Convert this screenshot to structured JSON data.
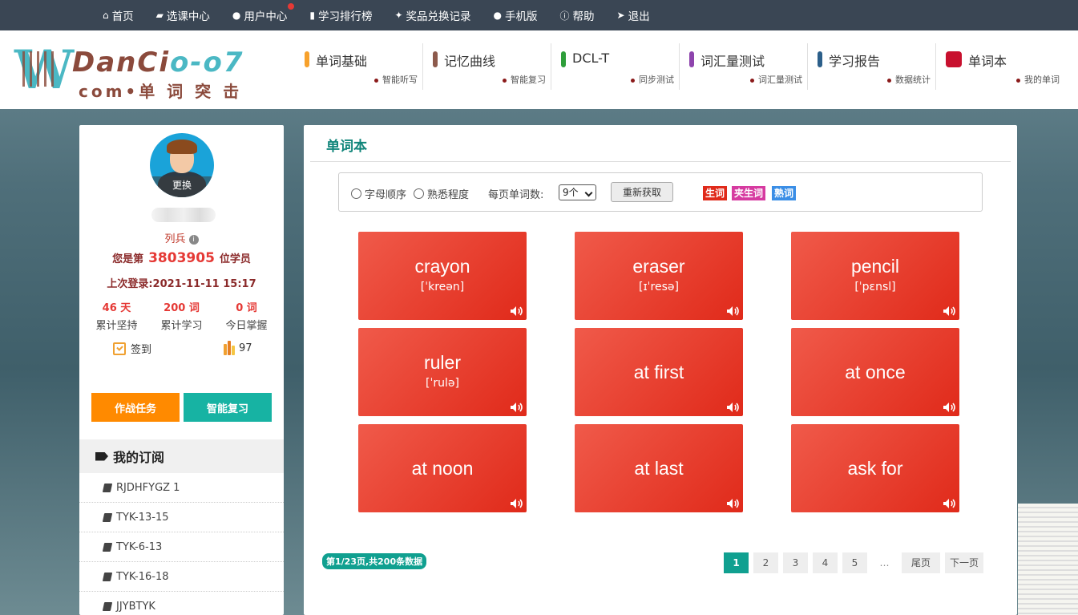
{
  "topnav": {
    "items": [
      {
        "icon": "home-icon",
        "glyph": "🏠",
        "label": "首页"
      },
      {
        "icon": "book-icon",
        "glyph": "📘",
        "label": "选课中心"
      },
      {
        "icon": "user-icon",
        "glyph": "👤",
        "label": "用户中心",
        "dot": true
      },
      {
        "icon": "bar-chart-icon",
        "glyph": "📊",
        "label": "学习排行榜"
      },
      {
        "icon": "gift-icon",
        "glyph": "🎁",
        "label": "奖品兑换记录"
      },
      {
        "icon": "apple-icon",
        "glyph": "",
        "label": "手机版"
      },
      {
        "icon": "info-icon",
        "glyph": "ⓘ",
        "label": "帮助"
      },
      {
        "icon": "send-icon",
        "glyph": "➤",
        "label": "退出"
      }
    ]
  },
  "logo": {
    "w": "W",
    "brand": "DanCi",
    "brand_tail": "o-o7",
    "sub": "com•单 词 突 击"
  },
  "mainnav": [
    {
      "label": "单词基础",
      "sub": "智能听写",
      "color": "#f7a12c"
    },
    {
      "label": "记忆曲线",
      "sub": "智能复习",
      "color": "#8d5a4c"
    },
    {
      "label": "DCL-T",
      "sub": "同步测试",
      "color": "#2e9e3a"
    },
    {
      "label": "词汇量测试",
      "sub": "词汇量测试",
      "color": "#8e44ad"
    },
    {
      "label": "学习报告",
      "sub": "数据统计",
      "color": "#2c5f8a"
    },
    {
      "label": "单词本",
      "sub": "我的单词",
      "color": "#c8102e"
    }
  ],
  "profile": {
    "change_label": "更换",
    "rank": "列兵",
    "order_prefix": "您是第",
    "order_num": "3803905",
    "order_suffix": "位学员",
    "last_login": "上次登录:2021-11-11 15:17",
    "stats": [
      {
        "value": "46 天",
        "label": "累计坚持"
      },
      {
        "value": "200 词",
        "label": "累计学习"
      },
      {
        "value": "0 词",
        "label": "今日掌握"
      }
    ],
    "sign_label": "签到",
    "pencil_count": "97",
    "task_button": "作战任务",
    "review_button": "智能复习"
  },
  "subscriptions": {
    "title": "我的订阅",
    "items": [
      "RJDHFYGZ 1",
      "TYK-13-15",
      "TYK-6-13",
      "TYK-16-18",
      "JJYBTYK"
    ]
  },
  "wordbook": {
    "title": "单词本",
    "filters": {
      "sort_alpha": "字母顺序",
      "sort_familiar": "熟悉程度",
      "per_page_label": "每页单词数:",
      "per_page_value": "9个",
      "refetch": "重新获取"
    },
    "legend": [
      {
        "label": "生词",
        "color": "#e02a1a"
      },
      {
        "label": "夹生词",
        "color": "#d63aa0"
      },
      {
        "label": "熟词",
        "color": "#3a8ee6"
      }
    ],
    "words": [
      {
        "word": "crayon",
        "phonetic": "[ˈkreən]"
      },
      {
        "word": "eraser",
        "phonetic": "[ɪˈresə]"
      },
      {
        "word": "pencil",
        "phonetic": "[ˈpɛnsl]"
      },
      {
        "word": "ruler",
        "phonetic": "[ˈrulə]"
      },
      {
        "word": "at first",
        "phonetic": ""
      },
      {
        "word": "at once",
        "phonetic": ""
      },
      {
        "word": "at noon",
        "phonetic": ""
      },
      {
        "word": "at last",
        "phonetic": ""
      },
      {
        "word": "ask for",
        "phonetic": ""
      }
    ],
    "page_info": "第1/23页,共200条数据",
    "pager": [
      "1",
      "2",
      "3",
      "4",
      "5",
      "…",
      "尾页",
      "下一页"
    ]
  }
}
